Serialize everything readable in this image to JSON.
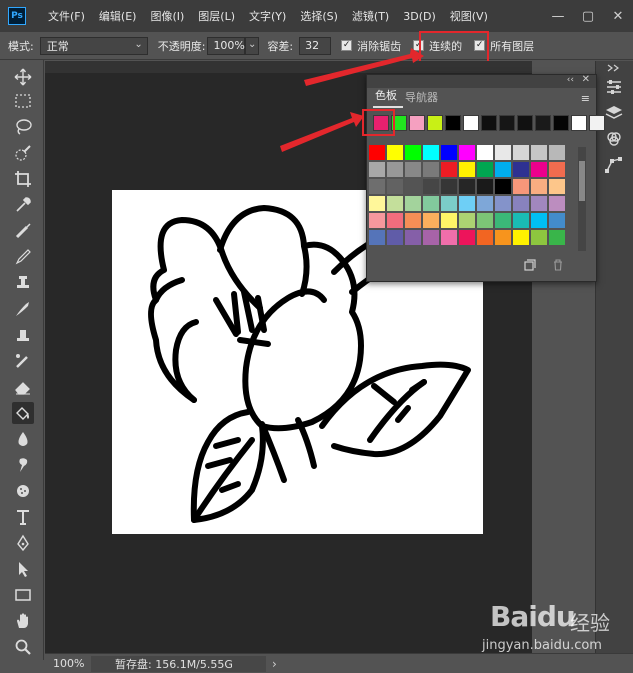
{
  "app": {
    "logo_text": "Ps"
  },
  "menu": [
    "文件(F)",
    "编辑(E)",
    "图像(I)",
    "图层(L)",
    "文字(Y)",
    "选择(S)",
    "滤镜(T)",
    "3D(D)",
    "视图(V)"
  ],
  "window_controls": {
    "minimize": "—",
    "maximize": "▢",
    "close": "✕"
  },
  "options": {
    "mode_label": "模式:",
    "mode_value": "正常",
    "opacity_label": "不透明度:",
    "opacity_value": "100%",
    "tolerance_label": "容差:",
    "tolerance_value": "32",
    "antialias_label": "消除锯齿",
    "antialias_checked": true,
    "contiguous_label": "连续的",
    "contiguous_checked": true,
    "all_layers_label": "所有图层",
    "all_layers_checked": true
  },
  "tools": [
    "move",
    "marquee",
    "lasso",
    "quick-select",
    "crop",
    "eyedropper",
    "healing-brush",
    "brush",
    "clone-stamp",
    "history-brush",
    "eraser",
    "paint-bucket",
    "blur",
    "dodge",
    "pen-alt",
    "type",
    "pen",
    "path-select",
    "rectangle",
    "hand",
    "zoom"
  ],
  "active_tool": "paint-bucket",
  "swatches_panel": {
    "tab_swatches": "色板",
    "tab_navigator": "导航器",
    "recent": [
      "#e8206e",
      "#22e41f",
      "#f5a0c0",
      "#c8f016",
      "#000000",
      "#ffffff",
      "#0f0f0f",
      "#161616",
      "#111111",
      "#1a1a1a",
      "#050505",
      "#ffffff",
      "#f2f2f2"
    ],
    "grid": [
      [
        "#ff0000",
        "#ffff00",
        "#00ff00",
        "#00ffff",
        "#0000ff",
        "#ff00ff",
        "#ffffff",
        "#e8e8e8",
        "#d6d6d6",
        "#c6c6c6",
        "#b8b8b8"
      ],
      [
        "#a8a8a8",
        "#989898",
        "#888888",
        "#7a7a7a",
        "#ed1c24",
        "#fff200",
        "#00a651",
        "#00aeef",
        "#2e3192",
        "#ec008c",
        "#f26c4f"
      ],
      [
        "#6e6e6e",
        "#626262",
        "#545454",
        "#464646",
        "#363636",
        "#262626",
        "#1a1a1a",
        "#000000",
        "#f7977a",
        "#f9ad81",
        "#fdc68a"
      ],
      [
        "#fff79a",
        "#c4df9b",
        "#a3d39c",
        "#82ca9d",
        "#7bcdc8",
        "#6ecff6",
        "#7ea7d8",
        "#8493ca",
        "#8882be",
        "#a187be",
        "#bc8dbf"
      ],
      [
        "#f6989d",
        "#f26d7d",
        "#f68e56",
        "#fbaf5d",
        "#fff467",
        "#acd372",
        "#7cc576",
        "#3bb878",
        "#1abbb4",
        "#00bff3",
        "#438ccb"
      ],
      [
        "#5574b9",
        "#605ca8",
        "#855fa8",
        "#a763a8",
        "#f06eaa",
        "#ed145b",
        "#f26522",
        "#f7941d",
        "#fff200",
        "#8dc63f",
        "#39b54a"
      ]
    ]
  },
  "status": {
    "zoom": "100%",
    "doc_info": "暂存盘: 156.1M/5.55G",
    "arrow": "›"
  },
  "watermark": {
    "brand": "Baidu",
    "brand_cn": "经验",
    "url": "jingyan.baidu.com"
  },
  "colors": {
    "highlight_red": "#e3272c",
    "foreground_swatch": "#e8206e",
    "ui_dark": "#535353"
  }
}
